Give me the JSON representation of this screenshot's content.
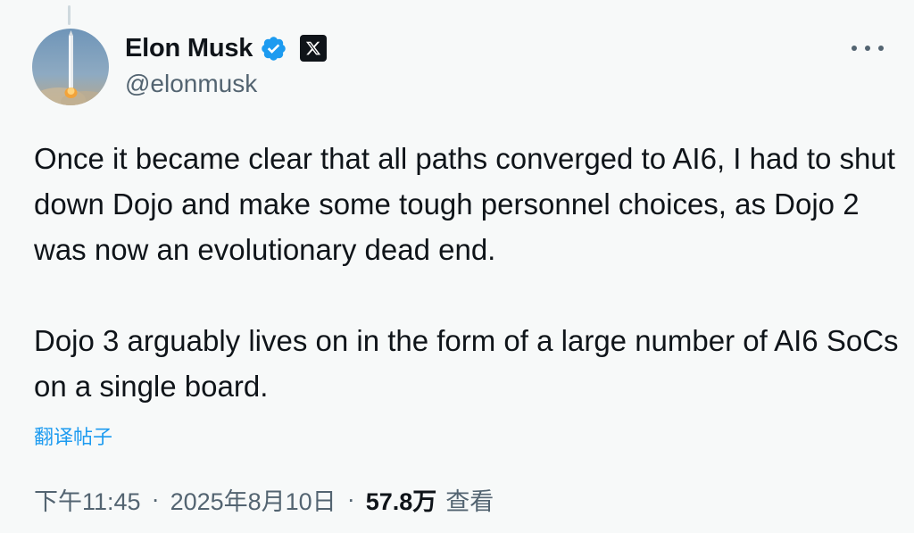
{
  "author": {
    "display_name": "Elon Musk",
    "handle": "@elonmusk",
    "verified_icon": "verified-badge-icon",
    "affiliation_icon": "x-logo-icon"
  },
  "tweet": {
    "paragraphs": [
      "Once it became clear that all paths converged to AI6, I had to shut down Dojo and make some tough personnel choices, as Dojo 2 was now an evolutionary dead end.",
      "Dojo 3 arguably lives on in the form of a large number of AI6 SoCs on a single board."
    ],
    "translate_label": "翻译帖子"
  },
  "meta": {
    "time": "下午11:45",
    "separator": "·",
    "date": "2025年8月10日",
    "views_count": "57.8万",
    "views_label": "查看"
  },
  "colors": {
    "accent": "#1d9bf0",
    "text_primary": "#0f1419",
    "text_secondary": "#536471",
    "background": "#f7f9f9"
  }
}
